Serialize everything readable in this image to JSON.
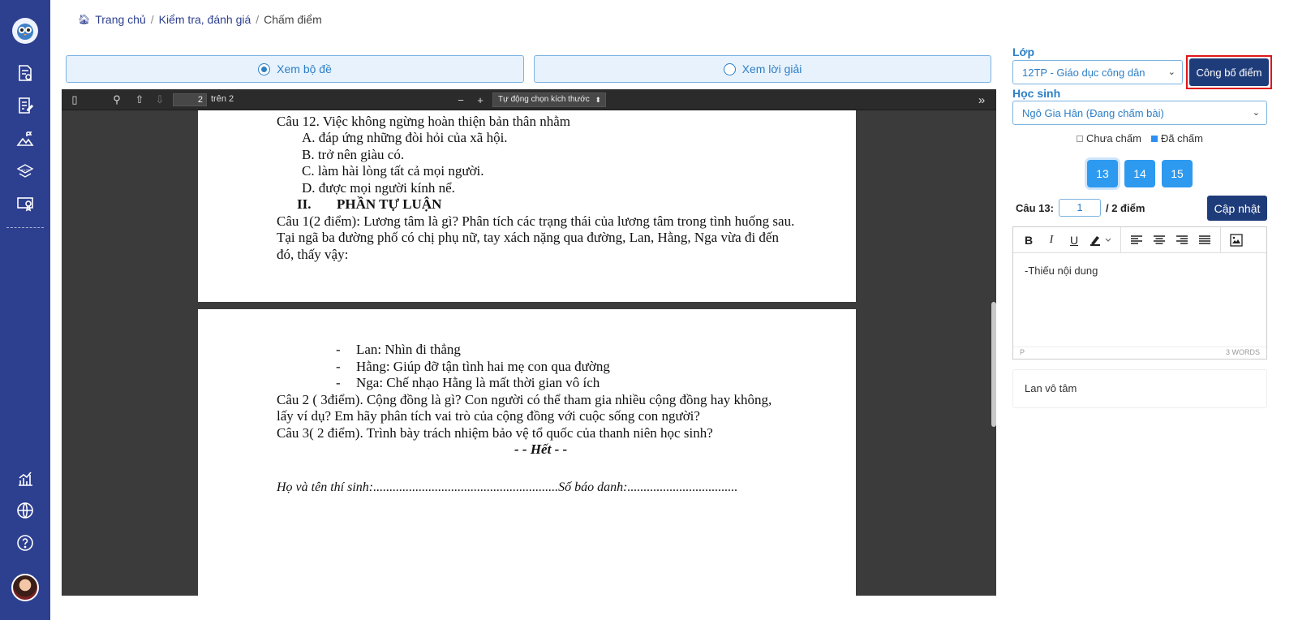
{
  "breadcrumb": {
    "home": "Trang chủ",
    "section": "Kiểm tra, đánh giá",
    "current": "Chấm điểm"
  },
  "view_toggle": {
    "questions": "Xem bộ đề",
    "solutions": "Xem lời giải"
  },
  "pdf_toolbar": {
    "page_number": "2",
    "page_of": "trên 2",
    "zoom": "Tự động chọn kích thước"
  },
  "pdf_pages": {
    "page1": [
      "Câu 12. Việc không ngừng hoàn thiện bản thân nhằm",
      "A.  đáp ứng những đòi hỏi của xã hội.",
      "B. trở nên giàu có.",
      "C. làm hài lòng tất cả mọi người.",
      "D. được mọi người kính nể.",
      "II.",
      "PHẦN TỰ LUẬN",
      "Câu 1(2 điểm): Lương tâm là gì? Phân tích các trạng thái của lương tâm trong tình huống sau.",
      "Tại ngã ba đường phố có chị phụ nữ, tay xách nặng qua đường, Lan, Hằng, Nga vừa đi đến",
      "đó, thấy vậy:"
    ],
    "page2": [
      "-",
      "Lan: Nhìn đi thẳng",
      "-",
      "Hằng: Giúp đỡ tận tình hai mẹ con qua đường",
      "-",
      "Nga: Chế nhạo Hằng là mất thời gian vô ích",
      "Câu 2 (   3điểm). Cộng đồng là gì? Con người có thể tham gia nhiều cộng đồng hay không,",
      "lấy ví dụ? Em hãy phân tích vai trò của cộng đồng với cuộc sống con người?",
      "Câu 3( 2 điểm). Trình bày trách nhiệm bảo vệ tổ quốc của thanh niên học sinh?",
      "- - Hết - -",
      "Họ và tên thí sinh:.........................................................Số báo danh:.................................."
    ]
  },
  "panel": {
    "class_label": "Lớp",
    "class_value": "12TP - Giáo dục công dân",
    "publish_button": "Công bố điểm",
    "student_label": "Học sinh",
    "student_value": "Ngô Gia Hân (Đang chấm bài)",
    "legend_ungraded": "Chưa chấm",
    "legend_graded": "Đã chấm",
    "questions": [
      "13",
      "14",
      "15"
    ],
    "score_label": "Câu 13:",
    "score_value": "1",
    "score_max": "/ 2 điểm",
    "update_button": "Cập nhật",
    "comment_text": "-Thiếu nội dung",
    "editor_path": "P",
    "editor_wordcount": "3 WORDS",
    "student_answer": "Lan vô tâm"
  },
  "colors": {
    "sidebar": "#2d3f8f",
    "accent": "#2d7fc6",
    "primary_button": "#1f3c7a",
    "question_button": "#2d9af0",
    "highlight_outline": "#e0161b"
  },
  "icons": [
    "owl-logo-icon",
    "exam-list-icon",
    "edit-document-icon",
    "chart-mountain-icon",
    "ielts-icon",
    "certificate-icon",
    "statistics-icon",
    "globe-icon",
    "help-icon"
  ]
}
